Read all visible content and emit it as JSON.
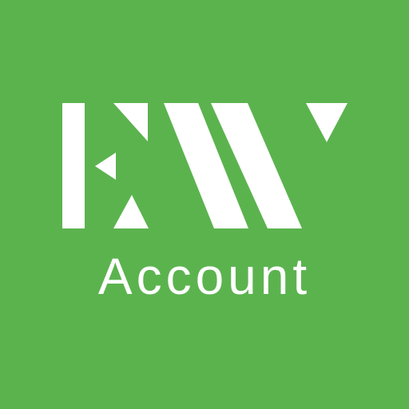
{
  "app": {
    "brand_color": "#5bb34e",
    "foreground_color": "#ffffff",
    "logo_icon": "ew-logo-icon",
    "logo_text": "EW",
    "subtitle": "Account"
  }
}
